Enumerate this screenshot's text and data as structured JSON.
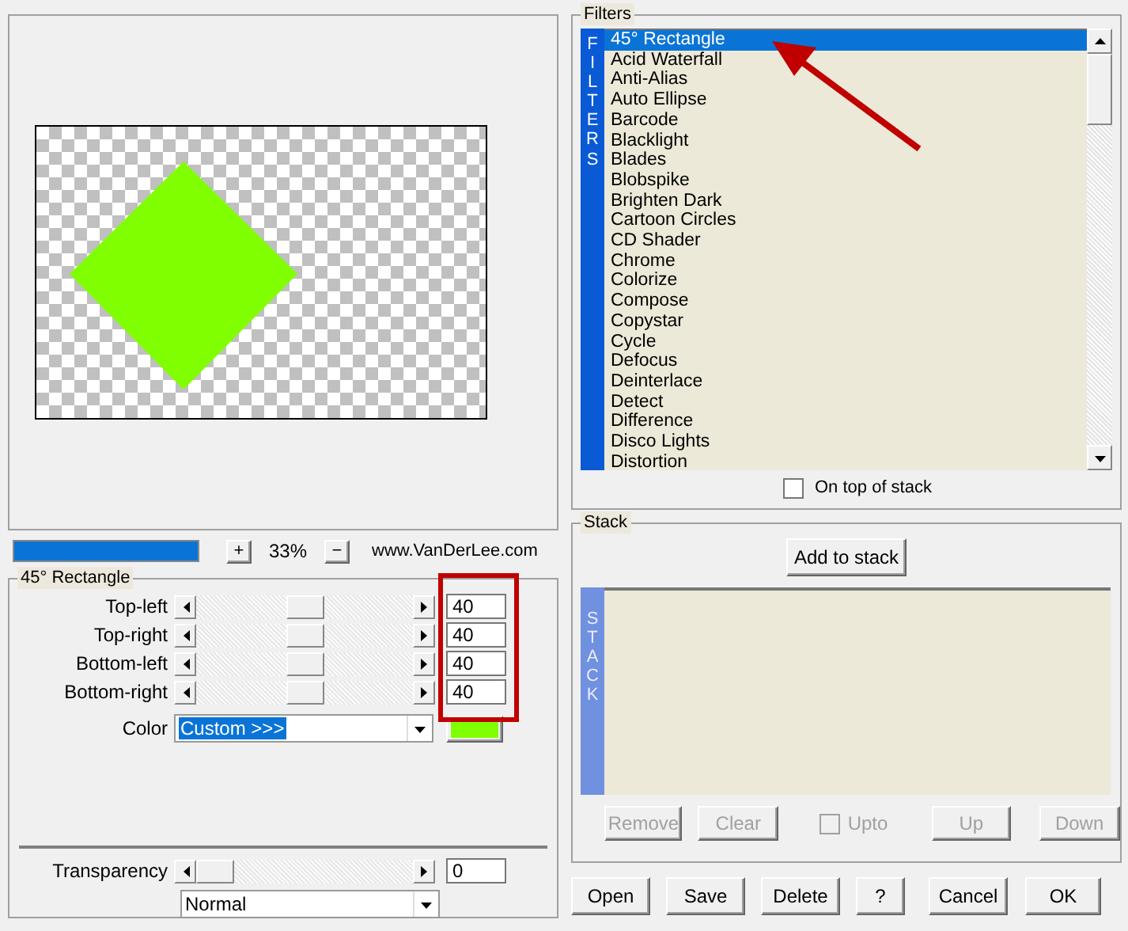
{
  "preview": {
    "progress": {
      "level": 1
    },
    "zoom_in": "+",
    "zoom": "33%",
    "zoom_out": "−",
    "site": "www.VanDerLee.com"
  },
  "filter_panel": {
    "title": "45° Rectangle",
    "sliders": [
      {
        "label": "Top-left",
        "level": 0.5,
        "value": "40"
      },
      {
        "label": "Top-right",
        "level": 0.5,
        "value": "40"
      },
      {
        "label": "Bottom-left",
        "level": 0.5,
        "value": "40"
      },
      {
        "label": "Bottom-right",
        "level": 0.5,
        "value": "40"
      }
    ],
    "color": {
      "label": "Color",
      "value": "Custom >>>",
      "color": "#80ff00"
    },
    "transparency": {
      "label": "Transparency",
      "level": 0,
      "value": "0"
    },
    "blend_mode": "Normal"
  },
  "filters": {
    "title": "Filters",
    "side_label": "FILTERS",
    "items": [
      {
        "label": "45° Rectangle",
        "selected": true
      },
      {
        "label": "Acid Waterfall",
        "selected": false
      },
      {
        "label": "Anti-Alias",
        "selected": false
      },
      {
        "label": "Auto Ellipse",
        "selected": false
      },
      {
        "label": "Barcode",
        "selected": false
      },
      {
        "label": "Blacklight",
        "selected": false
      },
      {
        "label": "Blades",
        "selected": false
      },
      {
        "label": "Blobspike",
        "selected": false
      },
      {
        "label": "Brighten Dark",
        "selected": false
      },
      {
        "label": "Cartoon Circles",
        "selected": false
      },
      {
        "label": "CD Shader",
        "selected": false
      },
      {
        "label": "Chrome",
        "selected": false
      },
      {
        "label": "Colorize",
        "selected": false
      },
      {
        "label": "Compose",
        "selected": false
      },
      {
        "label": "Copystar",
        "selected": false
      },
      {
        "label": "Cycle",
        "selected": false
      },
      {
        "label": "Defocus",
        "selected": false
      },
      {
        "label": "Deinterlace",
        "selected": false
      },
      {
        "label": "Detect",
        "selected": false
      },
      {
        "label": "Difference",
        "selected": false
      },
      {
        "label": "Disco Lights",
        "selected": false
      },
      {
        "label": "Distortion",
        "selected": false
      }
    ],
    "on_top_of_stack": {
      "label": "On top of stack",
      "checked": false
    }
  },
  "stack": {
    "title": "Stack",
    "add_button": "Add to stack",
    "side_label": "STACK",
    "controls": [
      {
        "kind": "button",
        "label": "Remove",
        "disabled": true
      },
      {
        "kind": "button",
        "label": "Clear",
        "disabled": true
      },
      {
        "kind": "checkbox",
        "label": "Upto",
        "checked": false,
        "disabled": true
      },
      {
        "kind": "button",
        "label": "Up",
        "disabled": true
      },
      {
        "kind": "button",
        "label": "Down",
        "disabled": true
      }
    ]
  },
  "buttons": [
    "Open",
    "Save",
    "Delete",
    "?",
    "Cancel",
    "OK"
  ]
}
